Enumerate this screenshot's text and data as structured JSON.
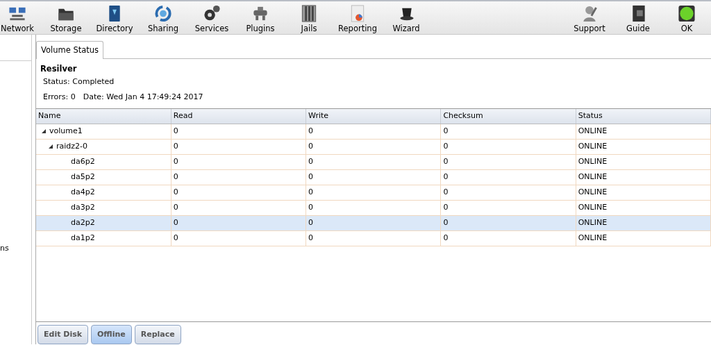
{
  "toolbar": {
    "left": [
      {
        "label": "Network",
        "kind": "network"
      },
      {
        "label": "Storage",
        "kind": "storage"
      },
      {
        "label": "Directory",
        "kind": "directory"
      },
      {
        "label": "Sharing",
        "kind": "sharing"
      },
      {
        "label": "Services",
        "kind": "services"
      },
      {
        "label": "Plugins",
        "kind": "plugins"
      },
      {
        "label": "Jails",
        "kind": "jails"
      },
      {
        "label": "Reporting",
        "kind": "reporting"
      },
      {
        "label": "Wizard",
        "kind": "wizard"
      }
    ],
    "right": [
      {
        "label": "Support",
        "kind": "support"
      },
      {
        "label": "Guide",
        "kind": "guide"
      },
      {
        "label": "OK",
        "kind": "ok"
      }
    ]
  },
  "sidebar": {
    "items": [
      "ns"
    ]
  },
  "tabs": [
    {
      "label": "Volume Status",
      "selected": true
    }
  ],
  "resilver": {
    "title": "Resilver",
    "status": "Status: Completed",
    "errors": "Errors: 0",
    "date": "Date: Wed Jan 4 17:49:24 2017"
  },
  "table": {
    "columns": [
      "Name",
      "Read",
      "Write",
      "Checksum",
      "Status"
    ],
    "rows": [
      {
        "name": "volume1",
        "read": "0",
        "write": "0",
        "checksum": "0",
        "status": "ONLINE",
        "selected": false,
        "expanded": true,
        "children": [
          {
            "name": "raidz2-0",
            "read": "0",
            "write": "0",
            "checksum": "0",
            "status": "ONLINE",
            "selected": false,
            "expanded": true,
            "children": [
              {
                "name": "da6p2",
                "read": "0",
                "write": "0",
                "checksum": "0",
                "status": "ONLINE",
                "selected": false
              },
              {
                "name": "da5p2",
                "read": "0",
                "write": "0",
                "checksum": "0",
                "status": "ONLINE",
                "selected": false
              },
              {
                "name": "da4p2",
                "read": "0",
                "write": "0",
                "checksum": "0",
                "status": "ONLINE",
                "selected": false
              },
              {
                "name": "da3p2",
                "read": "0",
                "write": "0",
                "checksum": "0",
                "status": "ONLINE",
                "selected": false
              },
              {
                "name": "da2p2",
                "read": "0",
                "write": "0",
                "checksum": "0",
                "status": "ONLINE",
                "selected": true
              },
              {
                "name": "da1p2",
                "read": "0",
                "write": "0",
                "checksum": "0",
                "status": "ONLINE",
                "selected": false
              }
            ]
          }
        ]
      }
    ]
  },
  "buttons": [
    {
      "label": "Edit Disk",
      "selected": false
    },
    {
      "label": "Offline",
      "selected": true
    },
    {
      "label": "Replace",
      "selected": false
    }
  ]
}
